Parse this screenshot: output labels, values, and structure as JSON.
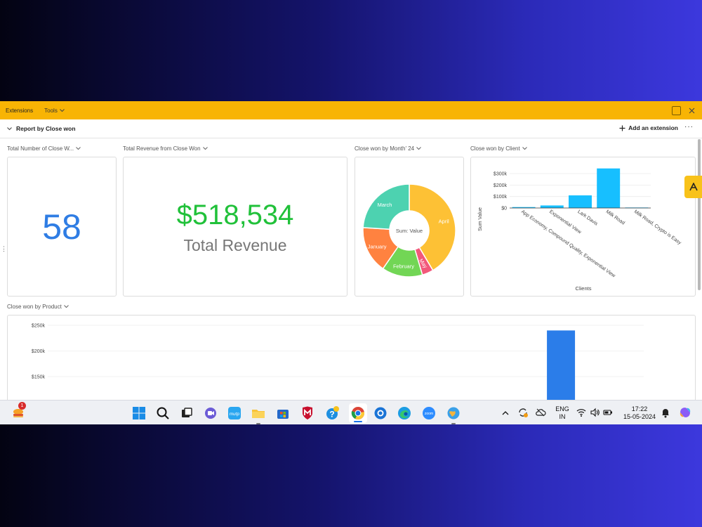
{
  "ext_bar": {
    "tab_extensions": "Extensions",
    "tab_tools": "Tools"
  },
  "report": {
    "title": "Report by Close won",
    "add_extension": "Add an extension",
    "more": "···"
  },
  "widgets": {
    "count": {
      "label": "Total Number of Close W...",
      "value": "58"
    },
    "revenue": {
      "label": "Total Revenue from Close Won",
      "value": "$518,534",
      "caption": "Total Revenue"
    },
    "by_month": {
      "label": "Close won by Month' 24"
    },
    "by_client": {
      "label": "Close won by Client"
    },
    "by_product": {
      "label": "Close won by Product"
    }
  },
  "chart_data": [
    {
      "type": "pie",
      "center_label": "Sum: Value",
      "categories": [
        "April",
        "May",
        "February",
        "January",
        "March"
      ],
      "values": [
        190000,
        18000,
        65000,
        75000,
        110000
      ],
      "colors": [
        "#fdc135",
        "#f2587a",
        "#72d655",
        "#ff8240",
        "#4dd2b0"
      ]
    },
    {
      "type": "bar",
      "categories": [
        "App Economy, Compound Quality, Exponential View",
        "Exponential View",
        "Lark Davis",
        "Milk Road",
        "Milk Road, Crypto is Easy"
      ],
      "values": [
        8000,
        22000,
        110000,
        345000,
        4000
      ],
      "ylabel": "Sum Value",
      "xlabel": "Clients",
      "ticks": [
        "$0",
        "$100k",
        "$200k",
        "$300k"
      ],
      "ylim": [
        0,
        380000
      ],
      "color": "#17bfff"
    },
    {
      "type": "bar",
      "categories": [
        "",
        "",
        "",
        "",
        "",
        "",
        "",
        "",
        "",
        "",
        "",
        "",
        "",
        "",
        "",
        "",
        "",
        ""
      ],
      "values": [
        0,
        0,
        0,
        0,
        0,
        0,
        0,
        0,
        0,
        0,
        0,
        0,
        0,
        0,
        0,
        240000,
        0,
        0
      ],
      "ticks": [
        "$150k",
        "$200k",
        "$250k"
      ],
      "ylim": [
        100000,
        260000
      ],
      "color": "#2b7de9"
    }
  ],
  "taskbar": {
    "weather_badge": "1",
    "lang": "ENG",
    "region": "IN",
    "time": "17:22",
    "date": "15-05-2024"
  }
}
